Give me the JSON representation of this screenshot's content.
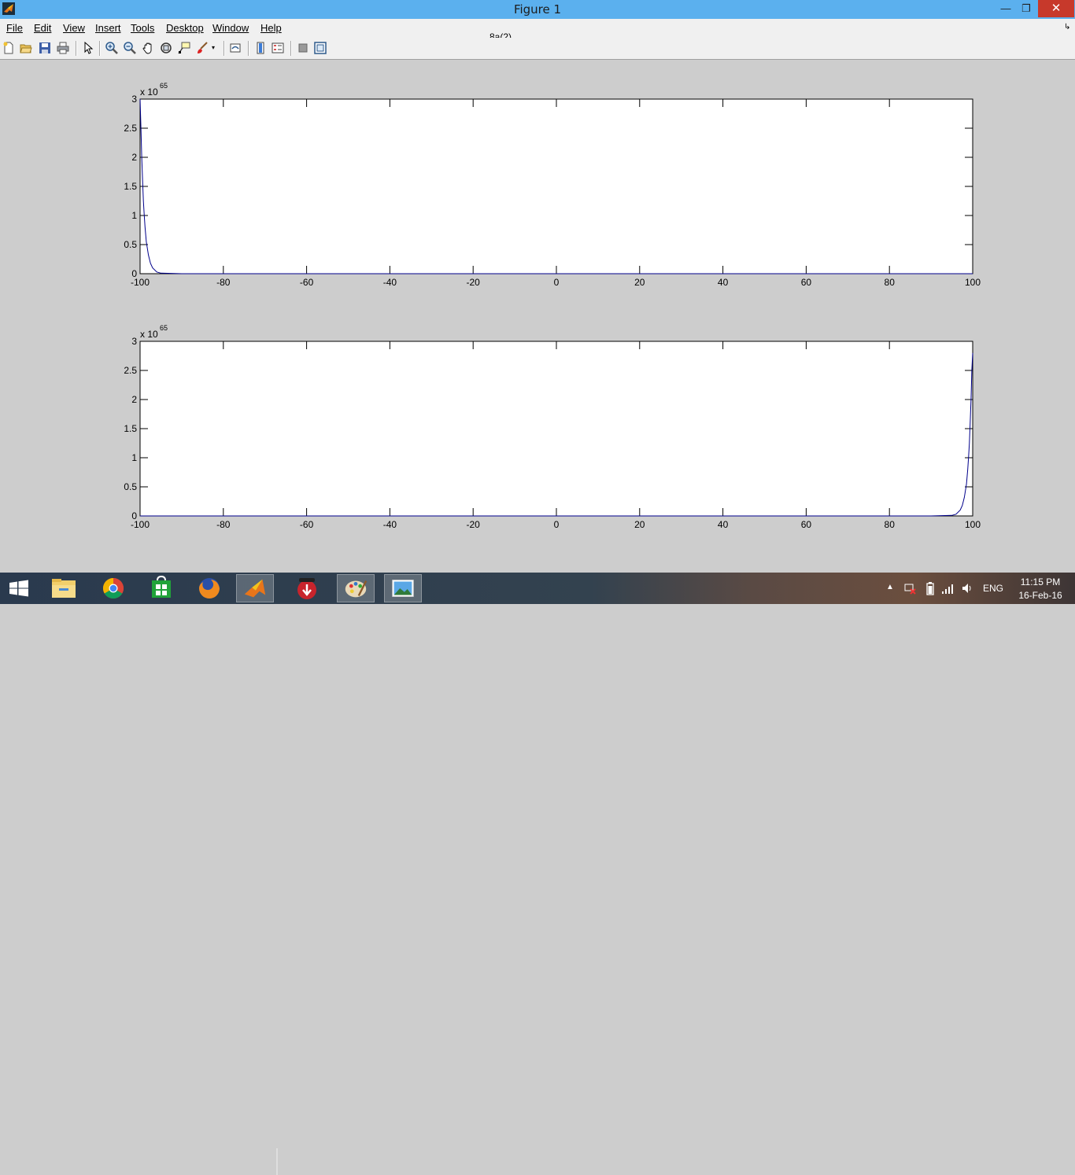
{
  "window": {
    "title": "Figure 1",
    "figure_name": "8a(2)"
  },
  "menu": [
    "File",
    "Edit",
    "View",
    "Insert",
    "Tools",
    "Desktop",
    "Window",
    "Help"
  ],
  "toolbar_icons": [
    "new-figure-icon",
    "open-file-icon",
    "save-icon",
    "print-icon",
    "edit-plot-icon",
    "zoom-in-icon",
    "zoom-out-icon",
    "pan-icon",
    "rotate-3d-icon",
    "data-cursor-icon",
    "brush-icon",
    "link-plot-icon",
    "insert-colorbar-icon",
    "insert-legend-icon",
    "hide-plot-tools-icon",
    "show-plot-tools-icon"
  ],
  "taskbar": {
    "apps": [
      "start-icon",
      "file-explorer-icon",
      "chrome-icon",
      "store-icon",
      "firefox-icon",
      "matlab-icon",
      "downloader-icon",
      "paint-icon",
      "photos-icon"
    ],
    "lang": "ENG",
    "time": "11:15 PM",
    "date": "16-Feb-16"
  },
  "chart_data": [
    {
      "type": "line",
      "title": "",
      "xlabel": "",
      "ylabel": "",
      "xlim": [
        -100,
        100
      ],
      "ylim": [
        0,
        3
      ],
      "y_exponent_label": "x 10",
      "y_exponent": "65",
      "xticks": [
        "-100",
        "-80",
        "-60",
        "-40",
        "-20",
        "0",
        "20",
        "40",
        "60",
        "80",
        "100"
      ],
      "yticks": [
        "0",
        "0.5",
        "1",
        "1.5",
        "2",
        "2.5",
        "3"
      ],
      "series": [
        {
          "color": "#00008b",
          "x": [
            -100,
            -99.8,
            -99.6,
            -99.4,
            -99.2,
            -99,
            -98.8,
            -98.5,
            -98,
            -97.5,
            -97,
            -96,
            -95,
            -90,
            -80,
            -60,
            -40,
            -20,
            0,
            20,
            40,
            60,
            80,
            100
          ],
          "y": [
            3,
            2.5,
            2.0,
            1.6,
            1.25,
            1.0,
            0.8,
            0.55,
            0.32,
            0.18,
            0.1,
            0.03,
            0.01,
            0,
            0,
            0,
            0,
            0,
            0,
            0,
            0,
            0,
            0,
            0
          ]
        }
      ]
    },
    {
      "type": "line",
      "title": "",
      "xlabel": "",
      "ylabel": "",
      "xlim": [
        -100,
        100
      ],
      "ylim": [
        0,
        3
      ],
      "y_exponent_label": "x 10",
      "y_exponent": "65",
      "xticks": [
        "-100",
        "-80",
        "-60",
        "-40",
        "-20",
        "0",
        "20",
        "40",
        "60",
        "80",
        "100"
      ],
      "yticks": [
        "0",
        "0.5",
        "1",
        "1.5",
        "2",
        "2.5",
        "3"
      ],
      "series": [
        {
          "color": "#00008b",
          "x": [
            -100,
            -80,
            -60,
            -40,
            -20,
            0,
            20,
            40,
            60,
            80,
            90,
            95,
            96,
            97,
            97.5,
            98,
            98.5,
            98.8,
            99,
            99.2,
            99.4,
            99.6,
            99.8,
            100
          ],
          "y": [
            0,
            0,
            0,
            0,
            0,
            0,
            0,
            0,
            0,
            0,
            0,
            0.01,
            0.03,
            0.1,
            0.18,
            0.32,
            0.55,
            0.8,
            1.0,
            1.25,
            1.6,
            2.0,
            2.5,
            2.8
          ]
        }
      ]
    }
  ]
}
